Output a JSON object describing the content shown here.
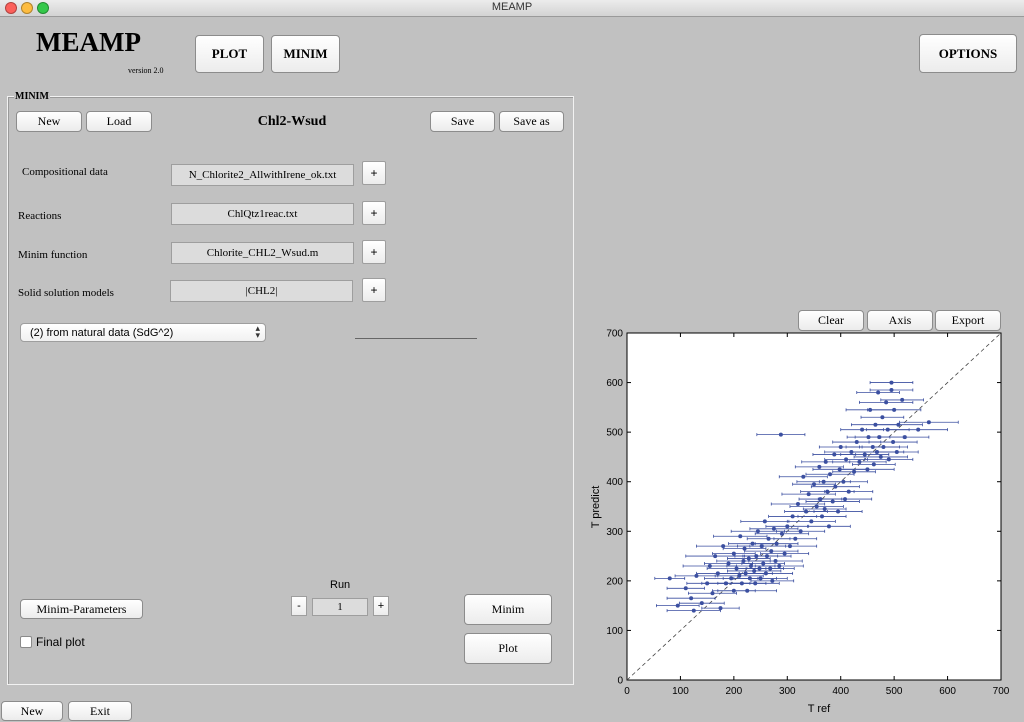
{
  "window": {
    "title": "MEAMP"
  },
  "header": {
    "logo": "MEAMP",
    "version": "version 2.0",
    "plot_button": "PLOT",
    "minim_button": "MINIM",
    "options_button": "OPTIONS"
  },
  "minim_panel": {
    "legend": "MINIM",
    "new_button": "New",
    "load_button": "Load",
    "project_name": "Chl2-Wsud",
    "save_button": "Save",
    "save_as_button": "Save as",
    "fields": [
      {
        "label": "Compositional data",
        "value": "N_Chlorite2_AllwithIrene_ok.txt",
        "add": "+"
      },
      {
        "label": "Reactions",
        "value": "ChlQtz1reac.txt",
        "add": "+"
      },
      {
        "label": "Minim function",
        "value": "Chlorite_CHL2_Wsud.m",
        "add": "+"
      },
      {
        "label": "Solid solution models",
        "value": "|CHL2|",
        "add": "+"
      }
    ],
    "method_select": "(2) from natural data (SdG^2)",
    "minim_parameters_button": "Minim-Parameters",
    "final_plot_label": "Final plot",
    "final_plot_checked": false,
    "run": {
      "label": "Run",
      "decrement": "-",
      "value": "1",
      "increment": "+"
    },
    "minim_button": "Minim",
    "plot_button": "Plot"
  },
  "footer": {
    "new_button": "New",
    "exit_button": "Exit"
  },
  "plot_toolbar": {
    "clear_button": "Clear",
    "axis_button": "Axis",
    "export_button": "Export"
  },
  "colors": {
    "series": "#3b4fa0",
    "diagonal": "#444444",
    "background": "#c1c1c1"
  },
  "chart_data": {
    "type": "scatter",
    "xlabel": "T ref",
    "ylabel": "T predict",
    "xlim": [
      0,
      700
    ],
    "ylim": [
      0,
      700
    ],
    "x_ticks": [
      "0",
      "100",
      "200",
      "300",
      "400",
      "500",
      "600",
      "700"
    ],
    "y_ticks": [
      "0",
      "100",
      "200",
      "300",
      "400",
      "500",
      "600",
      "700"
    ],
    "reference_line": "1:1 dashed",
    "error_bars": "horizontal",
    "points": [
      {
        "x": 80,
        "y": 205,
        "e": 28
      },
      {
        "x": 95,
        "y": 150,
        "e": 40
      },
      {
        "x": 110,
        "y": 185,
        "e": 35
      },
      {
        "x": 120,
        "y": 165,
        "e": 45
      },
      {
        "x": 130,
        "y": 210,
        "e": 40
      },
      {
        "x": 125,
        "y": 140,
        "e": 50
      },
      {
        "x": 140,
        "y": 155,
        "e": 42
      },
      {
        "x": 150,
        "y": 195,
        "e": 38
      },
      {
        "x": 155,
        "y": 230,
        "e": 50
      },
      {
        "x": 160,
        "y": 175,
        "e": 45
      },
      {
        "x": 165,
        "y": 250,
        "e": 55
      },
      {
        "x": 170,
        "y": 215,
        "e": 40
      },
      {
        "x": 175,
        "y": 145,
        "e": 35
      },
      {
        "x": 180,
        "y": 270,
        "e": 50
      },
      {
        "x": 185,
        "y": 195,
        "e": 45
      },
      {
        "x": 190,
        "y": 235,
        "e": 45
      },
      {
        "x": 195,
        "y": 205,
        "e": 50
      },
      {
        "x": 200,
        "y": 255,
        "e": 40
      },
      {
        "x": 200,
        "y": 180,
        "e": 40
      },
      {
        "x": 205,
        "y": 225,
        "e": 55
      },
      {
        "x": 210,
        "y": 210,
        "e": 45
      },
      {
        "x": 212,
        "y": 290,
        "e": 50
      },
      {
        "x": 215,
        "y": 195,
        "e": 45
      },
      {
        "x": 218,
        "y": 240,
        "e": 50
      },
      {
        "x": 220,
        "y": 265,
        "e": 40
      },
      {
        "x": 222,
        "y": 215,
        "e": 50
      },
      {
        "x": 225,
        "y": 180,
        "e": 55
      },
      {
        "x": 228,
        "y": 245,
        "e": 40
      },
      {
        "x": 230,
        "y": 205,
        "e": 50
      },
      {
        "x": 232,
        "y": 230,
        "e": 45
      },
      {
        "x": 235,
        "y": 275,
        "e": 45
      },
      {
        "x": 238,
        "y": 220,
        "e": 50
      },
      {
        "x": 240,
        "y": 195,
        "e": 45
      },
      {
        "x": 242,
        "y": 250,
        "e": 40
      },
      {
        "x": 245,
        "y": 300,
        "e": 50
      },
      {
        "x": 248,
        "y": 225,
        "e": 45
      },
      {
        "x": 250,
        "y": 205,
        "e": 50
      },
      {
        "x": 252,
        "y": 270,
        "e": 45
      },
      {
        "x": 255,
        "y": 235,
        "e": 40
      },
      {
        "x": 258,
        "y": 320,
        "e": 45
      },
      {
        "x": 260,
        "y": 215,
        "e": 50
      },
      {
        "x": 262,
        "y": 250,
        "e": 45
      },
      {
        "x": 265,
        "y": 285,
        "e": 40
      },
      {
        "x": 268,
        "y": 225,
        "e": 45
      },
      {
        "x": 270,
        "y": 260,
        "e": 50
      },
      {
        "x": 272,
        "y": 200,
        "e": 40
      },
      {
        "x": 275,
        "y": 305,
        "e": 45
      },
      {
        "x": 278,
        "y": 240,
        "e": 50
      },
      {
        "x": 280,
        "y": 275,
        "e": 40
      },
      {
        "x": 285,
        "y": 230,
        "e": 45
      },
      {
        "x": 288,
        "y": 495,
        "e": 45
      },
      {
        "x": 290,
        "y": 295,
        "e": 50
      },
      {
        "x": 295,
        "y": 255,
        "e": 45
      },
      {
        "x": 300,
        "y": 310,
        "e": 40
      },
      {
        "x": 305,
        "y": 270,
        "e": 50
      },
      {
        "x": 310,
        "y": 330,
        "e": 45
      },
      {
        "x": 315,
        "y": 285,
        "e": 40
      },
      {
        "x": 320,
        "y": 355,
        "e": 50
      },
      {
        "x": 325,
        "y": 300,
        "e": 45
      },
      {
        "x": 330,
        "y": 410,
        "e": 45
      },
      {
        "x": 335,
        "y": 340,
        "e": 40
      },
      {
        "x": 340,
        "y": 375,
        "e": 50
      },
      {
        "x": 345,
        "y": 320,
        "e": 45
      },
      {
        "x": 350,
        "y": 395,
        "e": 40
      },
      {
        "x": 355,
        "y": 350,
        "e": 50
      },
      {
        "x": 360,
        "y": 430,
        "e": 45
      },
      {
        "x": 362,
        "y": 365,
        "e": 40
      },
      {
        "x": 365,
        "y": 330,
        "e": 45
      },
      {
        "x": 368,
        "y": 400,
        "e": 50
      },
      {
        "x": 370,
        "y": 345,
        "e": 40
      },
      {
        "x": 372,
        "y": 440,
        "e": 45
      },
      {
        "x": 375,
        "y": 380,
        "e": 50
      },
      {
        "x": 378,
        "y": 310,
        "e": 40
      },
      {
        "x": 380,
        "y": 415,
        "e": 45
      },
      {
        "x": 385,
        "y": 360,
        "e": 50
      },
      {
        "x": 388,
        "y": 455,
        "e": 40
      },
      {
        "x": 390,
        "y": 390,
        "e": 45
      },
      {
        "x": 395,
        "y": 340,
        "e": 45
      },
      {
        "x": 398,
        "y": 425,
        "e": 50
      },
      {
        "x": 400,
        "y": 470,
        "e": 40
      },
      {
        "x": 405,
        "y": 400,
        "e": 45
      },
      {
        "x": 408,
        "y": 365,
        "e": 50
      },
      {
        "x": 410,
        "y": 445,
        "e": 40
      },
      {
        "x": 415,
        "y": 380,
        "e": 45
      },
      {
        "x": 420,
        "y": 460,
        "e": 50
      },
      {
        "x": 425,
        "y": 420,
        "e": 40
      },
      {
        "x": 430,
        "y": 480,
        "e": 45
      },
      {
        "x": 435,
        "y": 440,
        "e": 50
      },
      {
        "x": 440,
        "y": 505,
        "e": 40
      },
      {
        "x": 445,
        "y": 455,
        "e": 45
      },
      {
        "x": 450,
        "y": 425,
        "e": 50
      },
      {
        "x": 452,
        "y": 490,
        "e": 40
      },
      {
        "x": 455,
        "y": 545,
        "e": 45
      },
      {
        "x": 460,
        "y": 470,
        "e": 50
      },
      {
        "x": 462,
        "y": 435,
        "e": 40
      },
      {
        "x": 465,
        "y": 515,
        "e": 45
      },
      {
        "x": 468,
        "y": 460,
        "e": 50
      },
      {
        "x": 470,
        "y": 580,
        "e": 40
      },
      {
        "x": 472,
        "y": 490,
        "e": 45
      },
      {
        "x": 475,
        "y": 450,
        "e": 50
      },
      {
        "x": 478,
        "y": 530,
        "e": 40
      },
      {
        "x": 480,
        "y": 470,
        "e": 45
      },
      {
        "x": 485,
        "y": 560,
        "e": 50
      },
      {
        "x": 488,
        "y": 505,
        "e": 40
      },
      {
        "x": 490,
        "y": 445,
        "e": 45
      },
      {
        "x": 495,
        "y": 600,
        "e": 40
      },
      {
        "x": 495,
        "y": 585,
        "e": 40
      },
      {
        "x": 498,
        "y": 480,
        "e": 45
      },
      {
        "x": 500,
        "y": 545,
        "e": 50
      },
      {
        "x": 505,
        "y": 460,
        "e": 40
      },
      {
        "x": 508,
        "y": 515,
        "e": 45
      },
      {
        "x": 515,
        "y": 565,
        "e": 40
      },
      {
        "x": 520,
        "y": 490,
        "e": 45
      },
      {
        "x": 545,
        "y": 505,
        "e": 55
      },
      {
        "x": 565,
        "y": 520,
        "e": 55
      }
    ]
  }
}
